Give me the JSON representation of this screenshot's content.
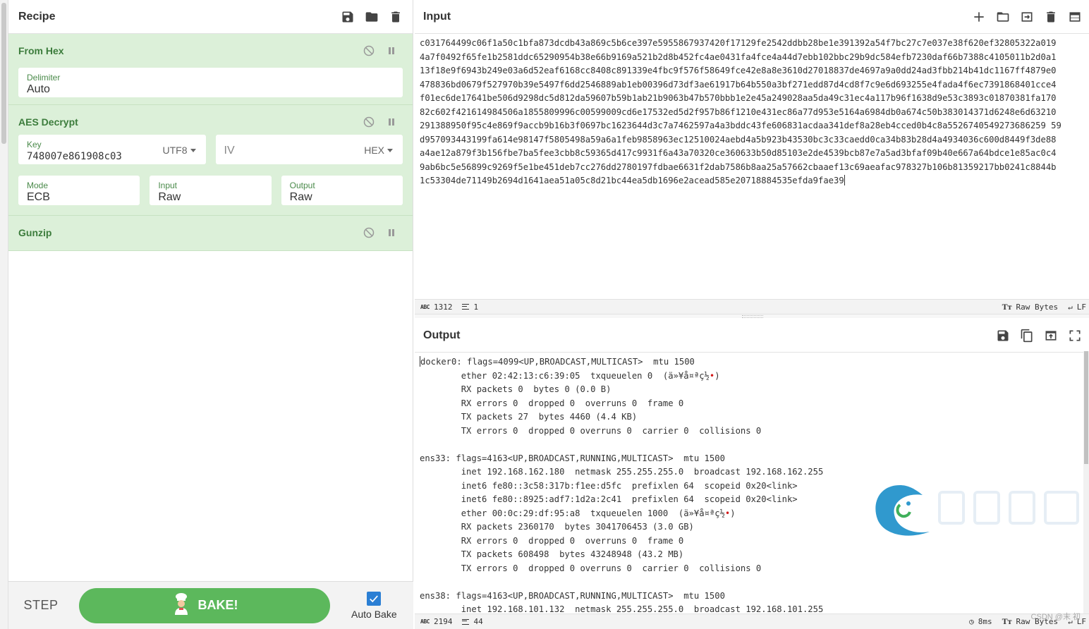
{
  "recipe": {
    "title": "Recipe",
    "operations": [
      {
        "name": "From Hex",
        "delimiter_label": "Delimiter",
        "delimiter_value": "Auto"
      },
      {
        "name": "AES Decrypt",
        "key_label": "Key",
        "key_value": "748007e861908c03",
        "key_encoding": "UTF8",
        "iv_placeholder": "IV",
        "iv_encoding": "HEX",
        "mode_label": "Mode",
        "mode_value": "ECB",
        "input_label": "Input",
        "input_value": "Raw",
        "output_label": "Output",
        "output_value": "Raw"
      },
      {
        "name": "Gunzip"
      }
    ]
  },
  "bake": {
    "step_label": "STEP",
    "bake_label": "BAKE!",
    "autobake_label": "Auto Bake",
    "autobake_checked": true
  },
  "input": {
    "title": "Input",
    "lines": [
      "c031764499c06f1a50c1bfa873dcdb43a869c5b6ce397e5955867937420f17129fe2542ddbb28be1e391392a54f7bc27c7e037e38f620ef32805322a019",
      "4a7f0492f65fe1b2581ddc65290954b38e66b9169a521b2d8b452fc4ae0431fa4fce4a44d7ebb102bbc29b9dc584efb7230daf66b7388c4105011b2d0a1",
      "13f18e9f6943b249e03a6d52eaf6168cc8408c891339e4fbc9f576f58649fce42e8a8e3610d27018837de4697a9a0dd24ad3fbb214b41dc1167ff4879e0",
      "478836bd0679f527970b39e5497f6dd2546889ab1eb00396d73df3ae61917b64b550a3bf271edd87d4cd8f7c9e6d693255e4fada4f6ec7391868401cce4",
      "f01ec6de17641be506d9298dc5d812da59607b59b1ab21b9063b47b570bbb1e2e45a249028aa5da49c31ec4a117b96f1638d9e53c3893c01870381fa170",
      "82c602f421614984506a1855809996c00599009cd6e17532ed5d2f957b86f1210e431ec86a77d953e5164a6984db0a674c50b383014371d6248e6d63210",
      "291388950f95c4e869f9accb9b16b3f0697bc1623644d3c7a7462597a4a3bddc43fe606831acdaa341def8a28eb4cced0b4c8a5526740549273686259 59",
      "d957093443199fa614e98147f5805498a59a6a1feb9858963ec12510024aebd4a5b923b43530bc3c33caedd0ca34b83b28d4a4934036c600d8449f3de88",
      "a4ae12a879f3b156fbe7ba5fee3cbb8c59365d417c9931f6a43a70320ce360633b50d85103e2de4539bcb87e7a5ad3bfaf09b40e667a64bdce1e85ac0c4",
      "9ab6bc5e56899c9269f5e1be451deb7cc276dd2780197fdbae6631f2dab7586b8aa25a57662cbaaef13c69aeafac978327b106b81359217bb0241c8844b",
      "1c53304de71149b2694d1641aea51a05c8d21bc44ea5db1696e2acead585e20718884535efda9fae39"
    ],
    "status": {
      "length": "1312",
      "lines": "1",
      "encoding": "Raw Bytes",
      "eol": "LF"
    }
  },
  "output": {
    "title": "Output",
    "lines": [
      "docker0: flags=4099<UP,BROADCAST,MULTICAST>  mtu 1500",
      "        ether 02:42:13:c6:39:05  txqueuelen 0  (ä»¥å¤ªç½•)",
      "        RX packets 0  bytes 0 (0.0 B)",
      "        RX errors 0  dropped 0  overruns 0  frame 0",
      "        TX packets 27  bytes 4460 (4.4 KB)",
      "        TX errors 0  dropped 0 overruns 0  carrier 0  collisions 0",
      "",
      "ens33: flags=4163<UP,BROADCAST,RUNNING,MULTICAST>  mtu 1500",
      "        inet 192.168.162.180  netmask 255.255.255.0  broadcast 192.168.162.255",
      "        inet6 fe80::3c58:317b:f1ee:d5fc  prefixlen 64  scopeid 0x20<link>",
      "        inet6 fe80::8925:adf7:1d2a:2c41  prefixlen 64  scopeid 0x20<link>",
      "        ether 00:0c:29:df:95:a8  txqueuelen 1000  (ä»¥å¤ªç½•)",
      "        RX packets 2360170  bytes 3041706453 (3.0 GB)",
      "        RX errors 0  dropped 0  overruns 0  frame 0",
      "        TX packets 608498  bytes 43248948 (43.2 MB)",
      "        TX errors 0  dropped 0 overruns 0  carrier 0  collisions 0",
      "",
      "ens38: flags=4163<UP,BROADCAST,RUNNING,MULTICAST>  mtu 1500",
      "        inet 192.168.101.132  netmask 255.255.255.0  broadcast 192.168.101.255"
    ],
    "status": {
      "length": "2194",
      "lines": "44",
      "time": "8ms",
      "encoding": "Raw Bytes",
      "eol": "LF"
    }
  },
  "watermark": {
    "text": "CSDN @末 初"
  },
  "colors": {
    "op_bg": "#dcf0d9",
    "op_title": "#3c7c3c",
    "bake_green": "#5cb85c",
    "checkbox_blue": "#2b7fd4"
  }
}
